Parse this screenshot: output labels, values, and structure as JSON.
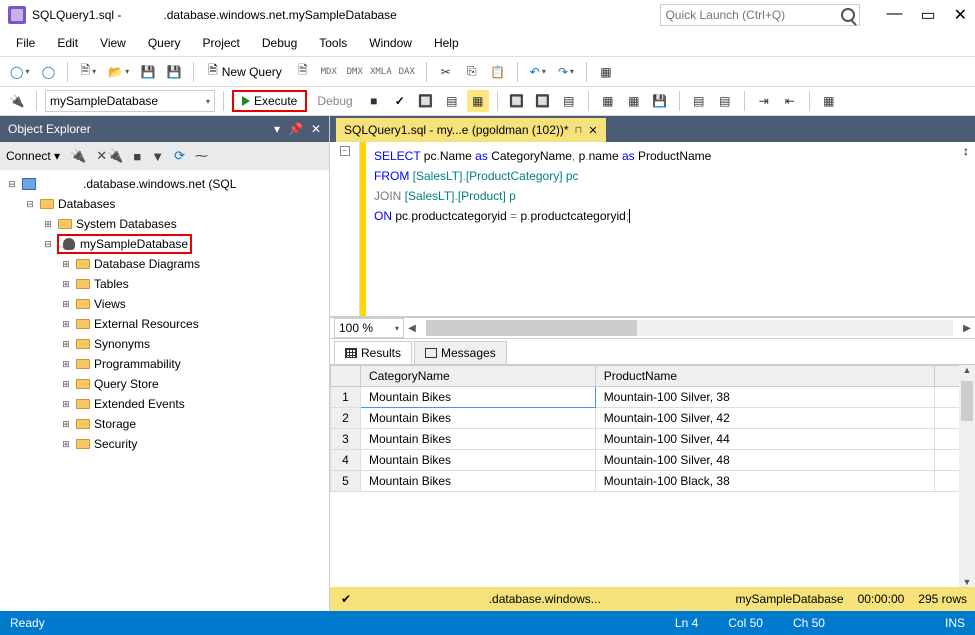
{
  "titlebar": {
    "title_left": "SQLQuery1.sql -",
    "title_right": ".database.windows.net.mySampleDatabase",
    "quicklaunch_placeholder": "Quick Launch (Ctrl+Q)"
  },
  "menu": [
    "File",
    "Edit",
    "View",
    "Query",
    "Project",
    "Debug",
    "Tools",
    "Window",
    "Help"
  ],
  "toolbar1": {
    "new_query": "New Query",
    "tags": [
      "MDX",
      "DMX",
      "XMLA",
      "DAX"
    ]
  },
  "toolbar2": {
    "db": "mySampleDatabase",
    "execute": "Execute",
    "debug": "Debug"
  },
  "explorer": {
    "title": "Object Explorer",
    "connect": "Connect",
    "server": ".database.windows.net (SQL",
    "databases": "Databases",
    "sysdb": "System Databases",
    "mydb": "mySampleDatabase",
    "children": [
      "Database Diagrams",
      "Tables",
      "Views",
      "External Resources",
      "Synonyms",
      "Programmability",
      "Query Store",
      "Extended Events",
      "Storage",
      "Security"
    ]
  },
  "editor": {
    "tab": "SQLQuery1.sql - my...e (pgoldman (102))*",
    "line1a": "SELECT",
    "line1b": " pc",
    "line1c": ".",
    "line1d": "Name ",
    "line1e": "as",
    "line1f": " CategoryName",
    "line1g": ",",
    "line1h": " p",
    "line1i": ".",
    "line1j": "name ",
    "line1k": "as",
    "line1l": " ProductName",
    "line2a": "FROM",
    "line2b": " [SalesLT]",
    "line2c": ".",
    "line2d": "[ProductCategory] pc",
    "line3a": "JOIN",
    "line3b": " [SalesLT]",
    "line3c": ".",
    "line3d": "[Product] p",
    "line4a": "ON",
    "line4b": " pc",
    "line4c": ".",
    "line4d": "productcategoryid ",
    "line4e": "=",
    "line4f": " p",
    "line4g": ".",
    "line4h": "productcategoryid",
    "line4i": ";",
    "zoom": "100 %"
  },
  "results": {
    "tab_results": "Results",
    "tab_messages": "Messages",
    "col1": "CategoryName",
    "col2": "ProductName",
    "rows": [
      {
        "n": "1",
        "c1": "Mountain Bikes",
        "c2": "Mountain-100 Silver, 38"
      },
      {
        "n": "2",
        "c1": "Mountain Bikes",
        "c2": "Mountain-100 Silver, 42"
      },
      {
        "n": "3",
        "c1": "Mountain Bikes",
        "c2": "Mountain-100 Silver, 44"
      },
      {
        "n": "4",
        "c1": "Mountain Bikes",
        "c2": "Mountain-100 Silver, 48"
      },
      {
        "n": "5",
        "c1": "Mountain Bikes",
        "c2": "Mountain-100 Black, 38"
      }
    ]
  },
  "yellow_status": {
    "server": ".database.windows...",
    "db": "mySampleDatabase",
    "time": "00:00:00",
    "rows": "295 rows"
  },
  "statusbar": {
    "ready": "Ready",
    "ln": "Ln 4",
    "col": "Col 50",
    "ch": "Ch 50",
    "ins": "INS"
  }
}
